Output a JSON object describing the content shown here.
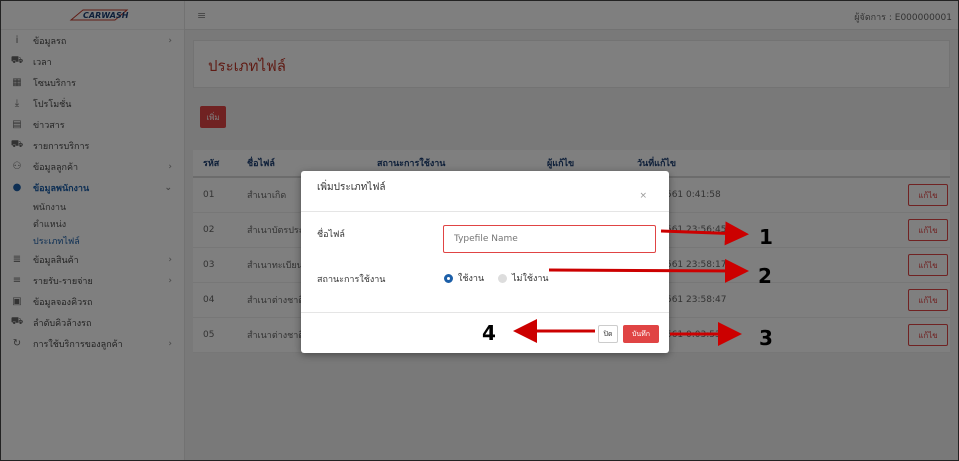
{
  "topbar": {
    "user_label": "ผู้จัดการ : E000000001"
  },
  "sidebar": {
    "items": [
      {
        "label": "ข้อมูลรถ",
        "icon": "info-icon",
        "glyph": "i",
        "chev": true
      },
      {
        "label": "เวลา",
        "icon": "car-icon",
        "glyph": "⛟",
        "chev": false
      },
      {
        "label": "โซนบริการ",
        "icon": "grid-icon",
        "glyph": "▦",
        "chev": false
      },
      {
        "label": "โปรโมชั่น",
        "icon": "download-icon",
        "glyph": "⤓",
        "chev": false
      },
      {
        "label": "ข่าวสาร",
        "icon": "news-icon",
        "glyph": "▤",
        "chev": false
      },
      {
        "label": "รายการบริการ",
        "icon": "car-icon",
        "glyph": "⛟",
        "chev": false
      },
      {
        "label": "ข้อมูลลูกค้า",
        "icon": "users-icon",
        "glyph": "⚇",
        "chev": true
      },
      {
        "label": "ข้อมูลพนักงาน",
        "icon": "user-circle-icon",
        "glyph": "●",
        "chev": true,
        "active": true
      }
    ],
    "subitems": [
      "พนักงาน",
      "ตำแหน่ง",
      "ประเภทไฟล์"
    ],
    "items2": [
      {
        "label": "ข้อมูลสินค้า",
        "icon": "list-icon",
        "glyph": "≣",
        "chev": true
      },
      {
        "label": "รายรับ-รายจ่าย",
        "icon": "money-icon",
        "glyph": "≡",
        "chev": true
      },
      {
        "label": "ข้อมูลจองคิวรถ",
        "icon": "calendar-icon",
        "glyph": "▣",
        "chev": false
      },
      {
        "label": "ลำดับคิวล้างรถ",
        "icon": "car-wash-icon",
        "glyph": "⛟",
        "chev": false
      },
      {
        "label": "การใช้บริการของลูกค้า",
        "icon": "history-icon",
        "glyph": "↻",
        "chev": true
      }
    ]
  },
  "page": {
    "title": "ประเภทไฟล์",
    "add_label": "เพิ่ม"
  },
  "table": {
    "headers": [
      "รหัส",
      "ชื่อไฟล์",
      "สถานะการใช้งาน",
      "ผู้แก้ไข",
      "วันที่แก้ไข"
    ],
    "edit_label": "แก้ไข",
    "rows": [
      {
        "id": "01",
        "name": "สำเนาเกิด",
        "date": "12/9/2561 0:41:58"
      },
      {
        "id": "02",
        "name": "สำเนาบัตรประชาชน",
        "date": "16/8/2561 23:56:45"
      },
      {
        "id": "03",
        "name": "สำเนาทะเบียนบ้าน",
        "date": "16/8/2561 23:58:17"
      },
      {
        "id": "04",
        "name": "สำเนาต่างชาติ",
        "date": "16/8/2561 23:58:47"
      },
      {
        "id": "05",
        "name": "สำเนาต่างชาติ",
        "date": "17/8/2561 0:03:53"
      }
    ]
  },
  "modal": {
    "title": "เพิ่มประเภทไฟล์",
    "close_x": "×",
    "name_label": "ชื่อไฟล์",
    "name_placeholder": "Typefile Name",
    "status_label": "สถานะการใช้งาน",
    "radio_on": "ใช้งาน",
    "radio_off": "ไม่ใช้งาน",
    "close_btn": "ปิด",
    "save_btn": "บันทึก"
  },
  "annotations": {
    "n1": "1",
    "n2": "2",
    "n3": "3",
    "n4": "4"
  },
  "colors": {
    "accent": "#e04444",
    "primary": "#1c5fa8",
    "arrow": "#cc0000"
  }
}
